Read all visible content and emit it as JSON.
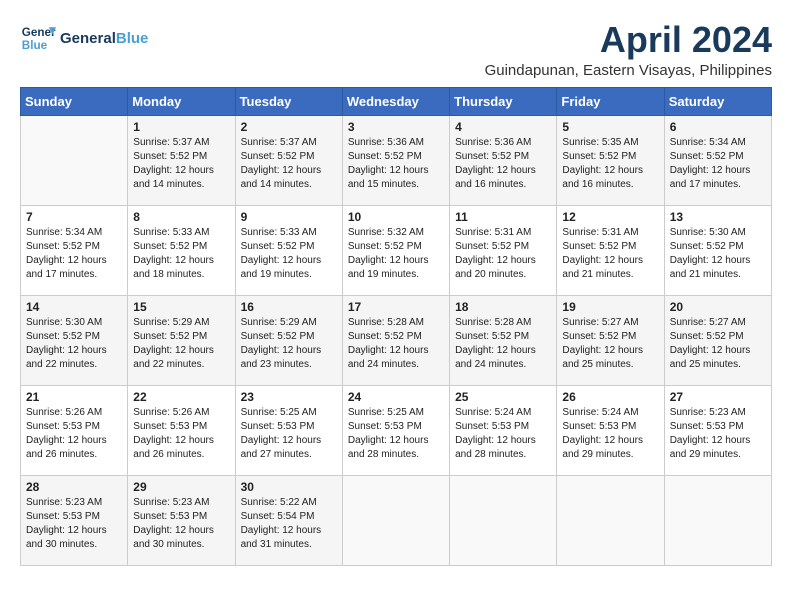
{
  "header": {
    "logo_line1": "General",
    "logo_line2": "Blue",
    "month_title": "April 2024",
    "subtitle": "Guindapunan, Eastern Visayas, Philippines"
  },
  "weekdays": [
    "Sunday",
    "Monday",
    "Tuesday",
    "Wednesday",
    "Thursday",
    "Friday",
    "Saturday"
  ],
  "weeks": [
    [
      {
        "day": "",
        "sunrise": "",
        "sunset": "",
        "daylight": ""
      },
      {
        "day": "1",
        "sunrise": "Sunrise: 5:37 AM",
        "sunset": "Sunset: 5:52 PM",
        "daylight": "Daylight: 12 hours and 14 minutes."
      },
      {
        "day": "2",
        "sunrise": "Sunrise: 5:37 AM",
        "sunset": "Sunset: 5:52 PM",
        "daylight": "Daylight: 12 hours and 14 minutes."
      },
      {
        "day": "3",
        "sunrise": "Sunrise: 5:36 AM",
        "sunset": "Sunset: 5:52 PM",
        "daylight": "Daylight: 12 hours and 15 minutes."
      },
      {
        "day": "4",
        "sunrise": "Sunrise: 5:36 AM",
        "sunset": "Sunset: 5:52 PM",
        "daylight": "Daylight: 12 hours and 16 minutes."
      },
      {
        "day": "5",
        "sunrise": "Sunrise: 5:35 AM",
        "sunset": "Sunset: 5:52 PM",
        "daylight": "Daylight: 12 hours and 16 minutes."
      },
      {
        "day": "6",
        "sunrise": "Sunrise: 5:34 AM",
        "sunset": "Sunset: 5:52 PM",
        "daylight": "Daylight: 12 hours and 17 minutes."
      }
    ],
    [
      {
        "day": "7",
        "sunrise": "Sunrise: 5:34 AM",
        "sunset": "Sunset: 5:52 PM",
        "daylight": "Daylight: 12 hours and 17 minutes."
      },
      {
        "day": "8",
        "sunrise": "Sunrise: 5:33 AM",
        "sunset": "Sunset: 5:52 PM",
        "daylight": "Daylight: 12 hours and 18 minutes."
      },
      {
        "day": "9",
        "sunrise": "Sunrise: 5:33 AM",
        "sunset": "Sunset: 5:52 PM",
        "daylight": "Daylight: 12 hours and 19 minutes."
      },
      {
        "day": "10",
        "sunrise": "Sunrise: 5:32 AM",
        "sunset": "Sunset: 5:52 PM",
        "daylight": "Daylight: 12 hours and 19 minutes."
      },
      {
        "day": "11",
        "sunrise": "Sunrise: 5:31 AM",
        "sunset": "Sunset: 5:52 PM",
        "daylight": "Daylight: 12 hours and 20 minutes."
      },
      {
        "day": "12",
        "sunrise": "Sunrise: 5:31 AM",
        "sunset": "Sunset: 5:52 PM",
        "daylight": "Daylight: 12 hours and 21 minutes."
      },
      {
        "day": "13",
        "sunrise": "Sunrise: 5:30 AM",
        "sunset": "Sunset: 5:52 PM",
        "daylight": "Daylight: 12 hours and 21 minutes."
      }
    ],
    [
      {
        "day": "14",
        "sunrise": "Sunrise: 5:30 AM",
        "sunset": "Sunset: 5:52 PM",
        "daylight": "Daylight: 12 hours and 22 minutes."
      },
      {
        "day": "15",
        "sunrise": "Sunrise: 5:29 AM",
        "sunset": "Sunset: 5:52 PM",
        "daylight": "Daylight: 12 hours and 22 minutes."
      },
      {
        "day": "16",
        "sunrise": "Sunrise: 5:29 AM",
        "sunset": "Sunset: 5:52 PM",
        "daylight": "Daylight: 12 hours and 23 minutes."
      },
      {
        "day": "17",
        "sunrise": "Sunrise: 5:28 AM",
        "sunset": "Sunset: 5:52 PM",
        "daylight": "Daylight: 12 hours and 24 minutes."
      },
      {
        "day": "18",
        "sunrise": "Sunrise: 5:28 AM",
        "sunset": "Sunset: 5:52 PM",
        "daylight": "Daylight: 12 hours and 24 minutes."
      },
      {
        "day": "19",
        "sunrise": "Sunrise: 5:27 AM",
        "sunset": "Sunset: 5:52 PM",
        "daylight": "Daylight: 12 hours and 25 minutes."
      },
      {
        "day": "20",
        "sunrise": "Sunrise: 5:27 AM",
        "sunset": "Sunset: 5:52 PM",
        "daylight": "Daylight: 12 hours and 25 minutes."
      }
    ],
    [
      {
        "day": "21",
        "sunrise": "Sunrise: 5:26 AM",
        "sunset": "Sunset: 5:53 PM",
        "daylight": "Daylight: 12 hours and 26 minutes."
      },
      {
        "day": "22",
        "sunrise": "Sunrise: 5:26 AM",
        "sunset": "Sunset: 5:53 PM",
        "daylight": "Daylight: 12 hours and 26 minutes."
      },
      {
        "day": "23",
        "sunrise": "Sunrise: 5:25 AM",
        "sunset": "Sunset: 5:53 PM",
        "daylight": "Daylight: 12 hours and 27 minutes."
      },
      {
        "day": "24",
        "sunrise": "Sunrise: 5:25 AM",
        "sunset": "Sunset: 5:53 PM",
        "daylight": "Daylight: 12 hours and 28 minutes."
      },
      {
        "day": "25",
        "sunrise": "Sunrise: 5:24 AM",
        "sunset": "Sunset: 5:53 PM",
        "daylight": "Daylight: 12 hours and 28 minutes."
      },
      {
        "day": "26",
        "sunrise": "Sunrise: 5:24 AM",
        "sunset": "Sunset: 5:53 PM",
        "daylight": "Daylight: 12 hours and 29 minutes."
      },
      {
        "day": "27",
        "sunrise": "Sunrise: 5:23 AM",
        "sunset": "Sunset: 5:53 PM",
        "daylight": "Daylight: 12 hours and 29 minutes."
      }
    ],
    [
      {
        "day": "28",
        "sunrise": "Sunrise: 5:23 AM",
        "sunset": "Sunset: 5:53 PM",
        "daylight": "Daylight: 12 hours and 30 minutes."
      },
      {
        "day": "29",
        "sunrise": "Sunrise: 5:23 AM",
        "sunset": "Sunset: 5:53 PM",
        "daylight": "Daylight: 12 hours and 30 minutes."
      },
      {
        "day": "30",
        "sunrise": "Sunrise: 5:22 AM",
        "sunset": "Sunset: 5:54 PM",
        "daylight": "Daylight: 12 hours and 31 minutes."
      },
      {
        "day": "",
        "sunrise": "",
        "sunset": "",
        "daylight": ""
      },
      {
        "day": "",
        "sunrise": "",
        "sunset": "",
        "daylight": ""
      },
      {
        "day": "",
        "sunrise": "",
        "sunset": "",
        "daylight": ""
      },
      {
        "day": "",
        "sunrise": "",
        "sunset": "",
        "daylight": ""
      }
    ]
  ]
}
